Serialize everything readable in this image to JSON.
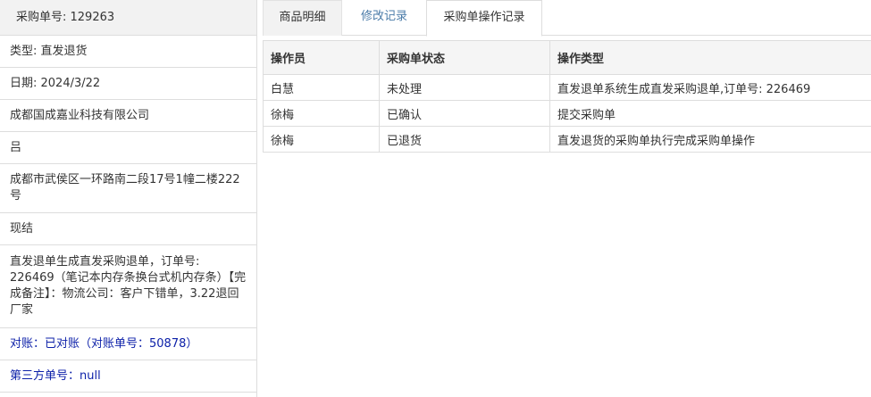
{
  "order": {
    "po_number_label": "采购单号: 129263",
    "fields": [
      "类型: 直发退货",
      "日期: 2024/3/22",
      "成都国成嘉业科技有限公司",
      "吕",
      "成都市武侯区一环路南二段17号1幢二楼222号",
      "现结",
      "直发退单生成直发采购退单，订单号: 226469（笔记本内存条换台式机内存条）【完成备注】：物流公司：客户下错单，3.22退回厂家",
      "对账：已对账（对账单号：50878）",
      "第三方单号：null"
    ]
  },
  "tabs": [
    {
      "label": "商品明细"
    },
    {
      "label": "修改记录"
    },
    {
      "label": "采购单操作记录"
    }
  ],
  "log_table": {
    "headers": [
      "操作员",
      "采购单状态",
      "操作类型"
    ],
    "rows": [
      [
        "白慧",
        "未处理",
        "直发退单系统生成直发采购退单,订单号: 226469"
      ],
      [
        "徐梅",
        "已确认",
        "提交采购单"
      ],
      [
        "徐梅",
        "已退货",
        "直发退货的采购单执行完成采购单操作"
      ]
    ]
  }
}
